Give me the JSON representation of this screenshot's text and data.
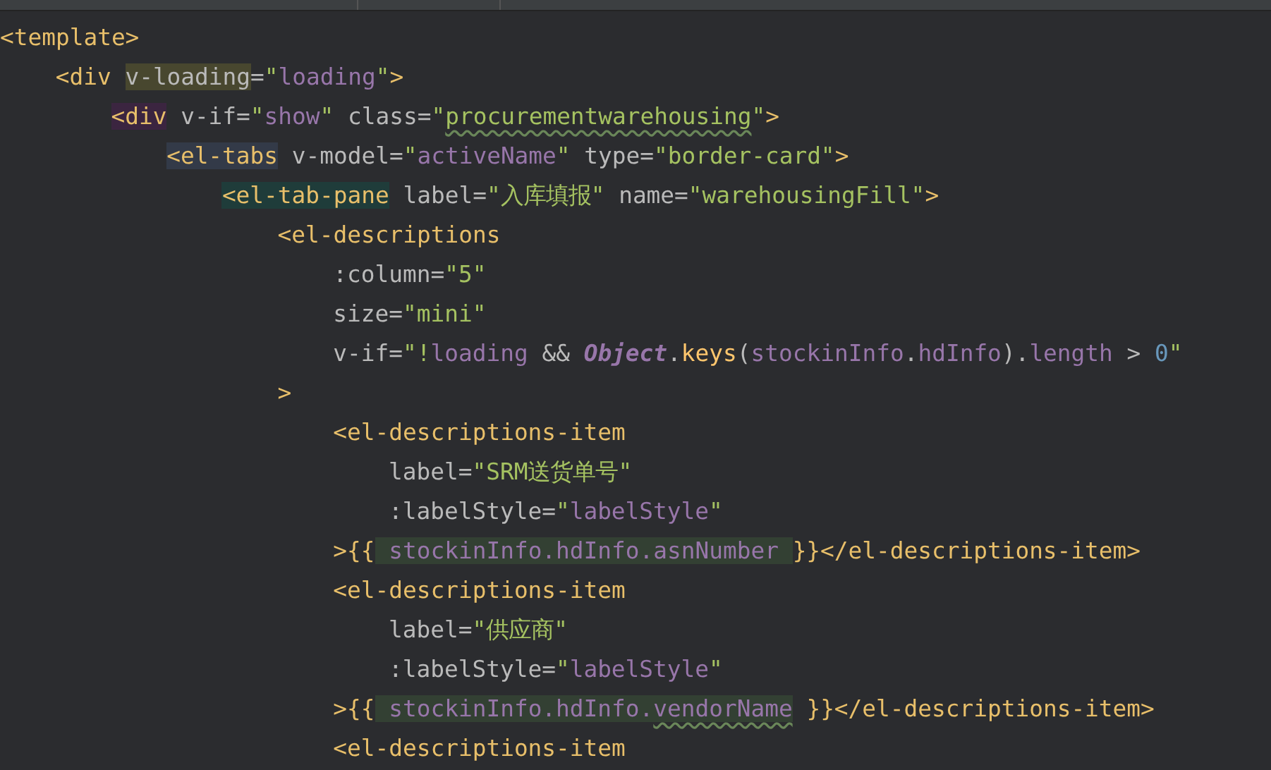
{
  "editor": {
    "lines": [
      {
        "tokens": [
          {
            "text": "<template>",
            "kind": "tag"
          }
        ]
      },
      {
        "tokens": [
          {
            "text": "    <div ",
            "kind": "tag"
          },
          {
            "text": "v-loading",
            "kind": "attr",
            "color": "#48472f"
          },
          {
            "text": "=",
            "kind": "punct"
          },
          {
            "text": "\"",
            "kind": "str"
          },
          {
            "text": "loading",
            "kind": "var"
          },
          {
            "text": "\"",
            "kind": "str"
          },
          {
            "text": ">",
            "kind": "tag"
          }
        ]
      },
      {
        "tokens": [
          {
            "text": "        <div",
            "kind": "tag",
            "color": "#3b2540"
          },
          {
            "text": " v-if",
            "kind": "attr"
          },
          {
            "text": "=",
            "kind": "punct"
          },
          {
            "text": "\"",
            "kind": "str"
          },
          {
            "text": "show",
            "kind": "var"
          },
          {
            "text": "\"",
            "kind": "str"
          },
          {
            "text": " class",
            "kind": "attr"
          },
          {
            "text": "=",
            "kind": "punct"
          },
          {
            "text": "\"",
            "kind": "str"
          },
          {
            "text": "procurementwarehousing",
            "kind": "str",
            "misspelled": true
          },
          {
            "text": "\"",
            "kind": "str"
          },
          {
            "text": ">",
            "kind": "tag"
          }
        ]
      },
      {
        "tokens": [
          {
            "text": "            <el-tabs",
            "kind": "tag",
            "color": "#333a48"
          },
          {
            "text": " v-model",
            "kind": "attr"
          },
          {
            "text": "=",
            "kind": "punct"
          },
          {
            "text": "\"",
            "kind": "str"
          },
          {
            "text": "activeName",
            "kind": "var"
          },
          {
            "text": "\"",
            "kind": "str"
          },
          {
            "text": " type",
            "kind": "attr"
          },
          {
            "text": "=",
            "kind": "punct"
          },
          {
            "text": "\"border-card\"",
            "kind": "str"
          },
          {
            "text": ">",
            "kind": "tag"
          }
        ]
      },
      {
        "tokens": [
          {
            "text": "                <el-tab-pane",
            "kind": "tag",
            "color": "#1f3c3a"
          },
          {
            "text": " label",
            "kind": "attr"
          },
          {
            "text": "=",
            "kind": "punct"
          },
          {
            "text": "\"入库填报\"",
            "kind": "str"
          },
          {
            "text": " name",
            "kind": "attr"
          },
          {
            "text": "=",
            "kind": "punct"
          },
          {
            "text": "\"warehousingFill\"",
            "kind": "str"
          },
          {
            "text": ">",
            "kind": "tag"
          }
        ]
      },
      {
        "tokens": [
          {
            "text": "                    <el-descriptions",
            "kind": "tag"
          }
        ]
      },
      {
        "tokens": [
          {
            "text": "                        :column",
            "kind": "attr"
          },
          {
            "text": "=",
            "kind": "punct"
          },
          {
            "text": "\"5\"",
            "kind": "str"
          }
        ]
      },
      {
        "tokens": [
          {
            "text": "                        size",
            "kind": "attr"
          },
          {
            "text": "=",
            "kind": "punct"
          },
          {
            "text": "\"mini\"",
            "kind": "str"
          }
        ]
      },
      {
        "tokens": [
          {
            "text": "                        v-if",
            "kind": "attr"
          },
          {
            "text": "=",
            "kind": "punct"
          },
          {
            "text": "\"!",
            "kind": "str"
          },
          {
            "text": "loading",
            "kind": "var"
          },
          {
            "text": " && ",
            "kind": "punct"
          },
          {
            "text": "Object",
            "kind": "obj"
          },
          {
            "text": ".",
            "kind": "punct"
          },
          {
            "text": "keys",
            "kind": "fn"
          },
          {
            "text": "(",
            "kind": "punct"
          },
          {
            "text": "stockinInfo",
            "kind": "var"
          },
          {
            "text": ".",
            "kind": "punct"
          },
          {
            "text": "hdInfo",
            "kind": "var"
          },
          {
            "text": ").",
            "kind": "punct"
          },
          {
            "text": "length",
            "kind": "var"
          },
          {
            "text": " > ",
            "kind": "punct"
          },
          {
            "text": "0",
            "kind": "num"
          },
          {
            "text": "\"",
            "kind": "str"
          }
        ]
      },
      {
        "tokens": [
          {
            "text": "                    >",
            "kind": "tag"
          }
        ]
      },
      {
        "tokens": [
          {
            "text": "                        <el-descriptions-item",
            "kind": "tag"
          }
        ]
      },
      {
        "tokens": [
          {
            "text": "                            label",
            "kind": "attr"
          },
          {
            "text": "=",
            "kind": "punct"
          },
          {
            "text": "\"SRM送货单号\"",
            "kind": "str"
          }
        ]
      },
      {
        "tokens": [
          {
            "text": "                            :labelStyle",
            "kind": "attr"
          },
          {
            "text": "=",
            "kind": "punct"
          },
          {
            "text": "\"",
            "kind": "str"
          },
          {
            "text": "labelStyle",
            "kind": "var"
          },
          {
            "text": "\"",
            "kind": "str"
          }
        ]
      },
      {
        "tokens": [
          {
            "text": "                        >{{",
            "kind": "tag"
          },
          {
            "text": " stockinInfo.hdInfo.asnNumber ",
            "kind": "var",
            "color": "#334033"
          },
          {
            "text": "}}</el-descriptions-item>",
            "kind": "tag"
          }
        ]
      },
      {
        "tokens": [
          {
            "text": "                        <el-descriptions-item",
            "kind": "tag"
          }
        ]
      },
      {
        "tokens": [
          {
            "text": "                            label",
            "kind": "attr"
          },
          {
            "text": "=",
            "kind": "punct"
          },
          {
            "text": "\"供应商\"",
            "kind": "str"
          }
        ]
      },
      {
        "tokens": [
          {
            "text": "                            :labelStyle",
            "kind": "attr"
          },
          {
            "text": "=",
            "kind": "punct"
          },
          {
            "text": "\"",
            "kind": "str"
          },
          {
            "text": "labelStyle",
            "kind": "var"
          },
          {
            "text": "\"",
            "kind": "str"
          }
        ]
      },
      {
        "tokens": [
          {
            "text": "                        >{{",
            "kind": "tag"
          },
          {
            "text": " stockinInfo.hdInfo.",
            "kind": "var",
            "color": "#334033"
          },
          {
            "text": "vendorName",
            "kind": "var",
            "color": "#334033",
            "misspelled": true
          },
          {
            "text": " }}</el-descriptions-item>",
            "kind": "tag"
          }
        ]
      },
      {
        "tokens": [
          {
            "text": "                        <el-descriptions-item",
            "kind": "tag"
          }
        ]
      }
    ]
  }
}
